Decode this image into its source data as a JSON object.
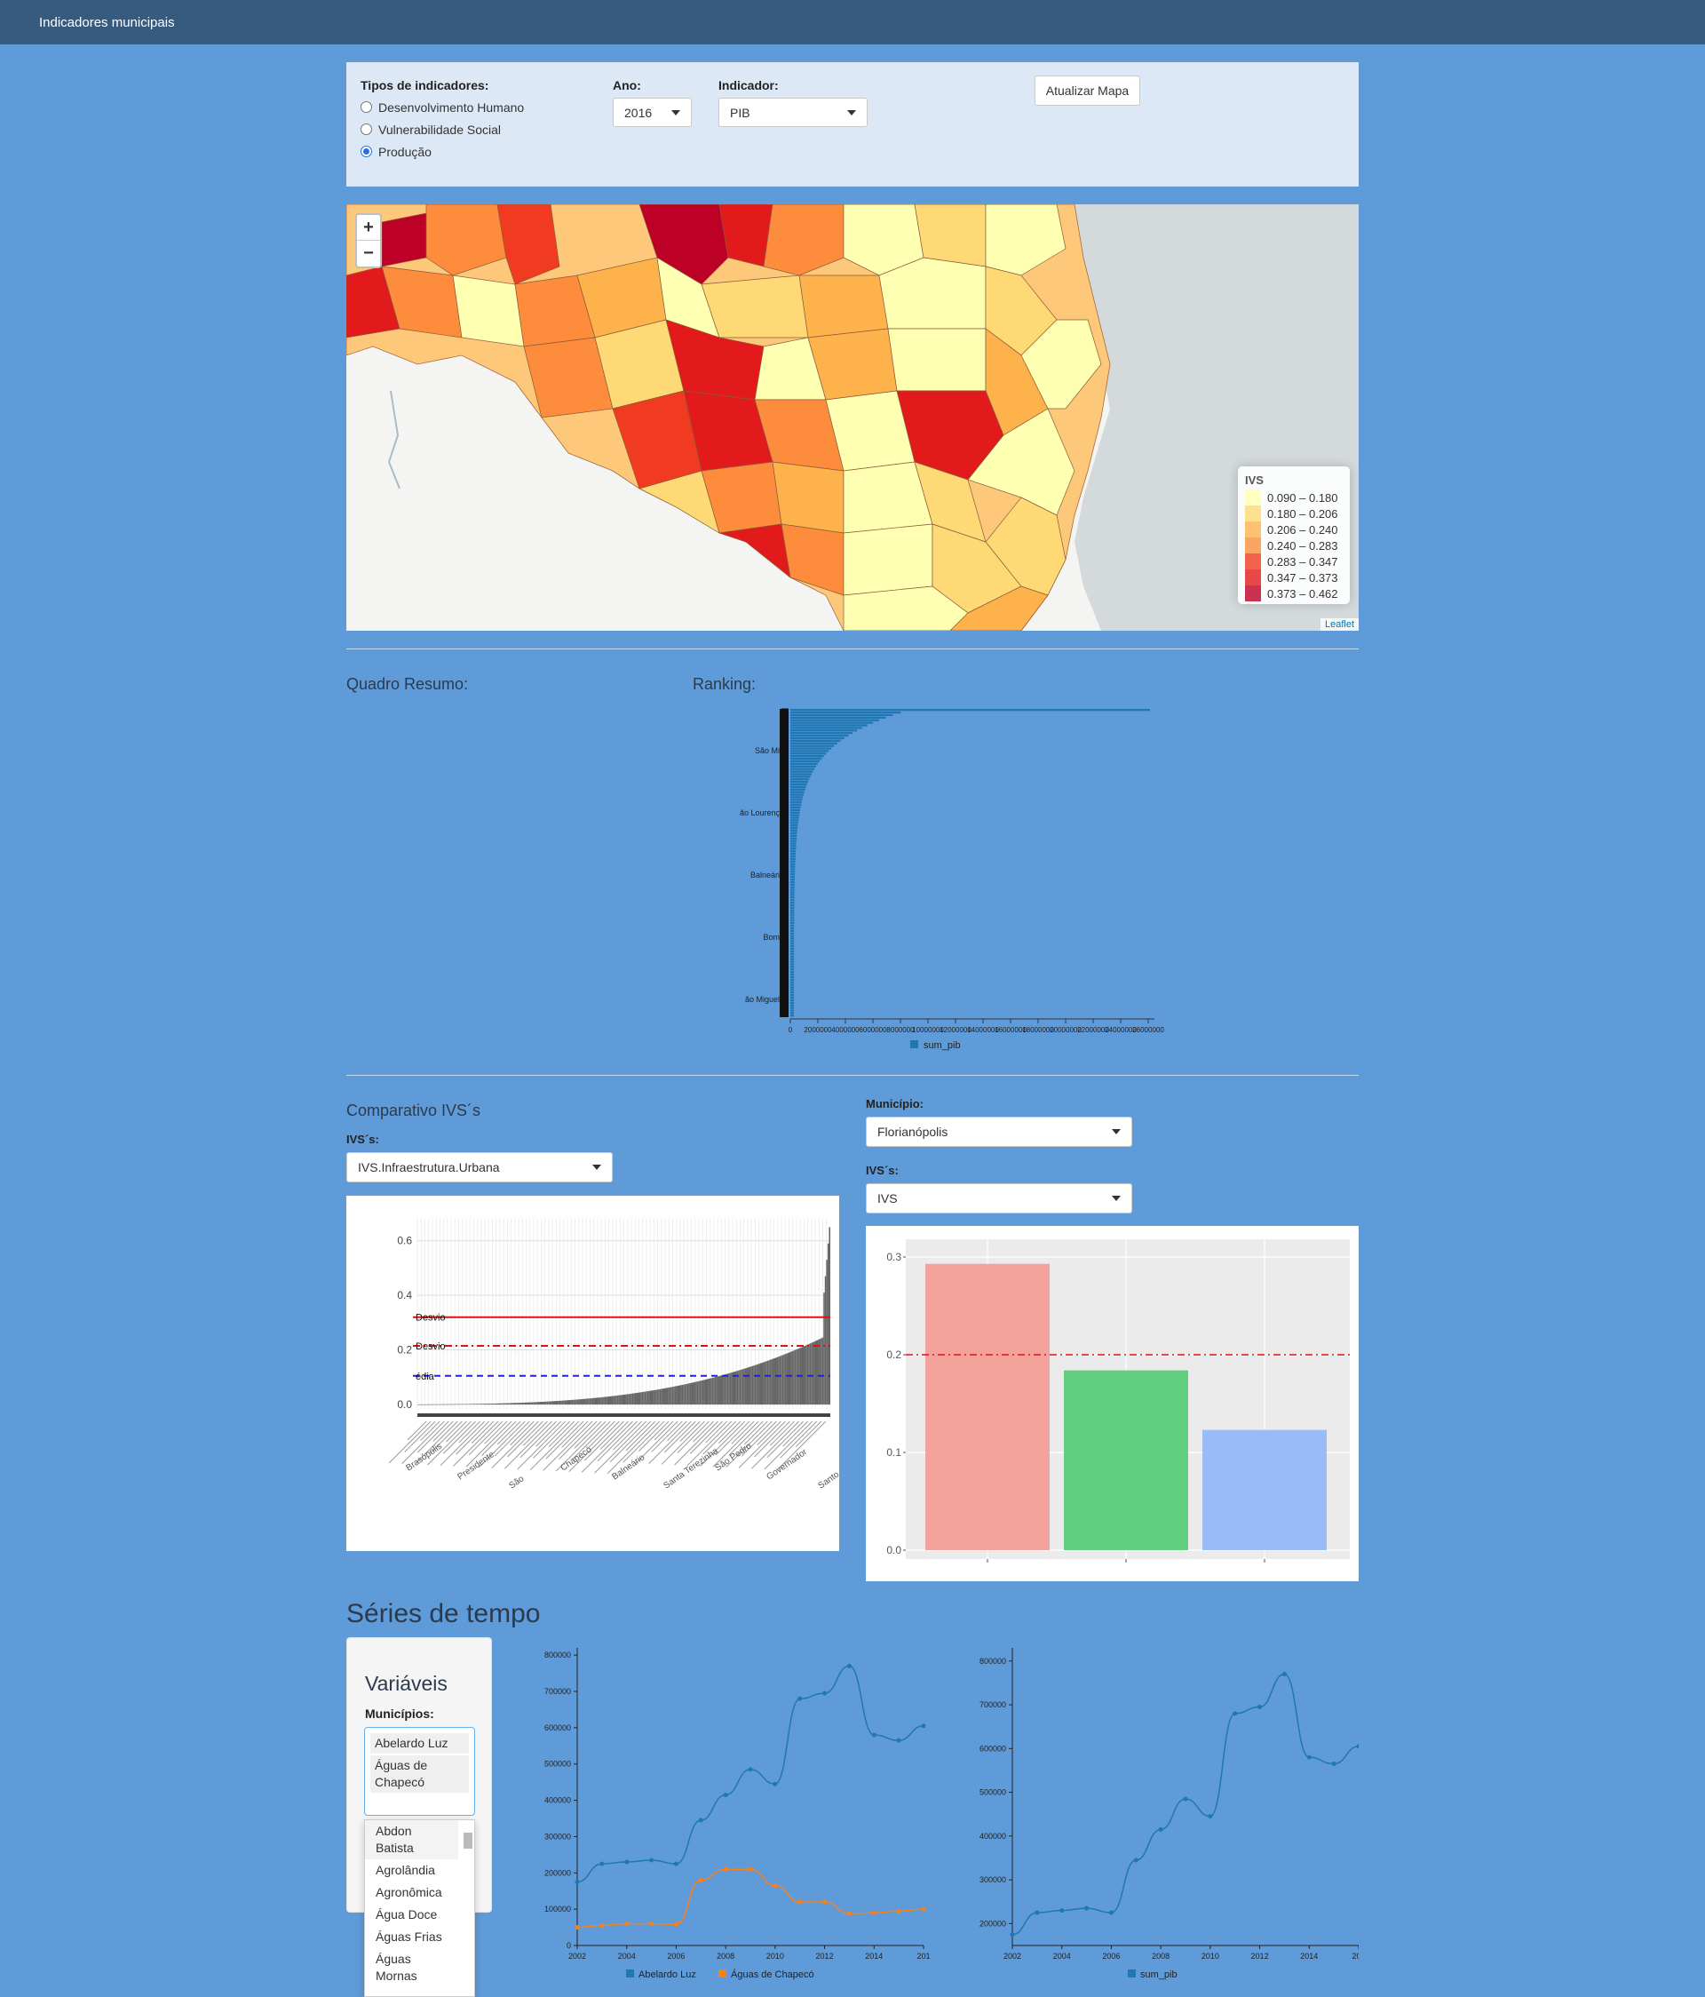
{
  "navbar": {
    "brand": "Indicadores municipais"
  },
  "controls": {
    "tipos_label": "Tipos de indicadores:",
    "tipos_options": [
      "Desenvolvimento Humano",
      "Vulnerabilidade Social",
      "Produção"
    ],
    "tipos_selected": 2,
    "ano_label": "Ano:",
    "ano_value": "2016",
    "indicador_label": "Indicador:",
    "indicador_value": "PIB",
    "update_button": "Atualizar Mapa"
  },
  "map": {
    "zoom_in": "+",
    "zoom_out": "−",
    "legend_title": "IVS",
    "legend": [
      {
        "label": "0.090 – 0.180",
        "color": "#ffffb2"
      },
      {
        "label": "0.180 – 0.206",
        "color": "#fed976"
      },
      {
        "label": "0.206 – 0.240",
        "color": "#feb24c"
      },
      {
        "label": "0.240 – 0.283",
        "color": "#fd8d3c"
      },
      {
        "label": "0.283 – 0.347",
        "color": "#f03b20"
      },
      {
        "label": "0.347 – 0.373",
        "color": "#e31a1c"
      },
      {
        "label": "0.373 – 0.462",
        "color": "#bd0026"
      }
    ],
    "attribution": "Leaflet"
  },
  "summary": {
    "quadro_title": "Quadro Resumo:",
    "ranking_title": "Ranking:"
  },
  "ranking_chart": {
    "x_ticks": [
      "0",
      "2000000",
      "4000000",
      "6000000",
      "8000000",
      "10000000",
      "12000000",
      "14000000",
      "16000000",
      "18000000",
      "20000000",
      "22000000",
      "24000000",
      "26000000"
    ],
    "legend": "sum_pib",
    "visible_labels": [
      "São Mi",
      "ão Lourenç",
      "Balneári",
      "Bom",
      "ão Miguel"
    ]
  },
  "comparativo": {
    "title": "Comparativo IVS´s",
    "ivs_label": "IVS´s:",
    "ivs_value": "IVS.Infraestrutura.Urbana",
    "y_ticks": [
      "0.0",
      "0.2",
      "0.4",
      "0.6"
    ],
    "line_labels": [
      "Desvio",
      "Desvio",
      "édia"
    ],
    "x_labels_sample": [
      "Brasópolis",
      "Presidente",
      "São",
      "Chapecó",
      "Balneário",
      "Santa Terezinha",
      "São Pedro",
      "Governador",
      "Santo Amaro"
    ]
  },
  "municipio": {
    "label": "Município:",
    "value": "Florianópolis",
    "ivs_label": "IVS´s:",
    "ivs_value": "IVS",
    "y_ticks": [
      "0.0",
      "0.1",
      "0.2",
      "0.3"
    ],
    "bars": [
      {
        "value": 0.293,
        "color": "#f4a29c"
      },
      {
        "value": 0.184,
        "color": "#61cf7f"
      },
      {
        "value": 0.123,
        "color": "#99bbf7"
      }
    ],
    "ref_line": 0.2
  },
  "series": {
    "title": "Séries de tempo",
    "variaveis": "Variáveis",
    "municipios_label": "Municípios:",
    "selected": [
      "Abelardo Luz",
      "Águas de Chapecó"
    ],
    "dropdown_options": [
      "Abdon Batista",
      "Agrolândia",
      "Agronômica",
      "Água Doce",
      "Águas Frias",
      "Águas Mornas"
    ]
  },
  "chart_data": [
    {
      "type": "line",
      "x": [
        2002,
        2003,
        2004,
        2005,
        2006,
        2007,
        2008,
        2009,
        2010,
        2011,
        2012,
        2013,
        2014,
        2015,
        2016
      ],
      "x_ticks": [
        "2002",
        "2004",
        "2006",
        "2008",
        "2010",
        "2012",
        "2014",
        "201"
      ],
      "y_ticks": [
        "0",
        "100000",
        "200000",
        "300000",
        "400000",
        "500000",
        "600000",
        "700000",
        "800000"
      ],
      "ylim": [
        0,
        820000
      ],
      "series": [
        {
          "name": "Abelardo Luz",
          "color": "#1f77b4",
          "values": [
            175000,
            225000,
            230000,
            235000,
            225000,
            345000,
            415000,
            485000,
            445000,
            680000,
            695000,
            770000,
            580000,
            565000,
            605000
          ]
        },
        {
          "name": "Águas de Chapecó",
          "color": "#ff7f0e",
          "values": [
            50000,
            55000,
            60000,
            60000,
            58000,
            180000,
            210000,
            210000,
            165000,
            120000,
            120000,
            88000,
            90000,
            95000,
            100000
          ]
        }
      ]
    },
    {
      "type": "line",
      "x": [
        2002,
        2003,
        2004,
        2005,
        2006,
        2007,
        2008,
        2009,
        2010,
        2011,
        2012,
        2013,
        2014,
        2015,
        2016
      ],
      "x_ticks": [
        "2002",
        "2004",
        "2006",
        "2008",
        "2010",
        "2012",
        "2014",
        "201"
      ],
      "y_ticks": [
        "200000",
        "300000",
        "400000",
        "500000",
        "600000",
        "700000",
        "800000"
      ],
      "ylim": [
        150000,
        830000
      ],
      "series": [
        {
          "name": "sum_pib",
          "color": "#1f77b4",
          "values": [
            175000,
            225000,
            230000,
            235000,
            225000,
            345000,
            415000,
            485000,
            445000,
            680000,
            695000,
            770000,
            580000,
            565000,
            605000
          ]
        }
      ]
    }
  ]
}
